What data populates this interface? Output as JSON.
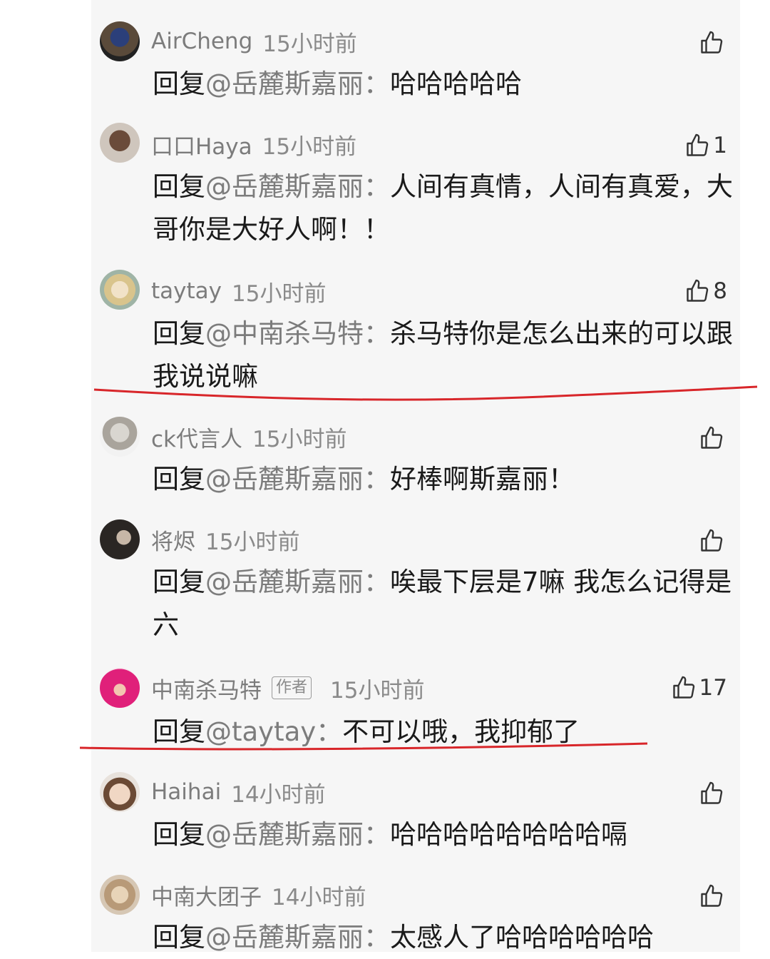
{
  "comments": [
    {
      "username": "AirCheng",
      "time": "15小时前",
      "likes": "",
      "reply_prefix": "回复",
      "mention": "@岳麓斯嘉丽",
      "colon": "：",
      "text": "哈哈哈哈哈",
      "avatar": "avatar-blue"
    },
    {
      "username": "口口Haya",
      "time": "15小时前",
      "likes": "1",
      "reply_prefix": "回复",
      "mention": "@岳麓斯嘉丽",
      "colon": "：",
      "text": "人间有真情，人间有真爱，大哥你是大好人啊！！",
      "avatar": "avatar-brown"
    },
    {
      "username": "taytay",
      "time": "15小时前",
      "likes": "8",
      "reply_prefix": "回复",
      "mention": "@中南杀马特",
      "colon": "：",
      "text": "杀马特你是怎么出来的可以跟我说说嘛",
      "avatar": "avatar-blonde"
    },
    {
      "username": "ck代言人",
      "time": "15小时前",
      "likes": "",
      "reply_prefix": "回复",
      "mention": "@岳麓斯嘉丽",
      "colon": "：",
      "text": "好棒啊斯嘉丽！",
      "avatar": "avatar-statue"
    },
    {
      "username": "将烬",
      "time": "15小时前",
      "likes": "",
      "reply_prefix": "回复",
      "mention": "@岳麓斯嘉丽",
      "colon": "：",
      "text": "唉最下层是7嘛 我怎么记得是六",
      "avatar": "avatar-dark"
    },
    {
      "username": "中南杀马特",
      "badge": "作者",
      "time": "15小时前",
      "likes": "17",
      "reply_prefix": "回复",
      "mention": "@taytay",
      "colon": "：",
      "text": "不可以哦，我抑郁了",
      "avatar": "avatar-pink"
    },
    {
      "username": "Haihai",
      "time": "14小时前",
      "likes": "",
      "reply_prefix": "回复",
      "mention": "@岳麓斯嘉丽",
      "colon": "：",
      "text": "哈哈哈哈哈哈哈哈嗝",
      "avatar": "avatar-face"
    },
    {
      "username": "中南大团子",
      "time": "14小时前",
      "likes": "",
      "reply_prefix": "回复",
      "mention": "@岳麓斯嘉丽",
      "colon": "：",
      "text": "太感人了哈哈哈哈哈哈",
      "avatar": "avatar-cat"
    }
  ],
  "colors": {
    "background": "#f6f6f6",
    "username": "#7c7c7c",
    "text": "#1a1a1a",
    "underline": "#d8262a"
  }
}
